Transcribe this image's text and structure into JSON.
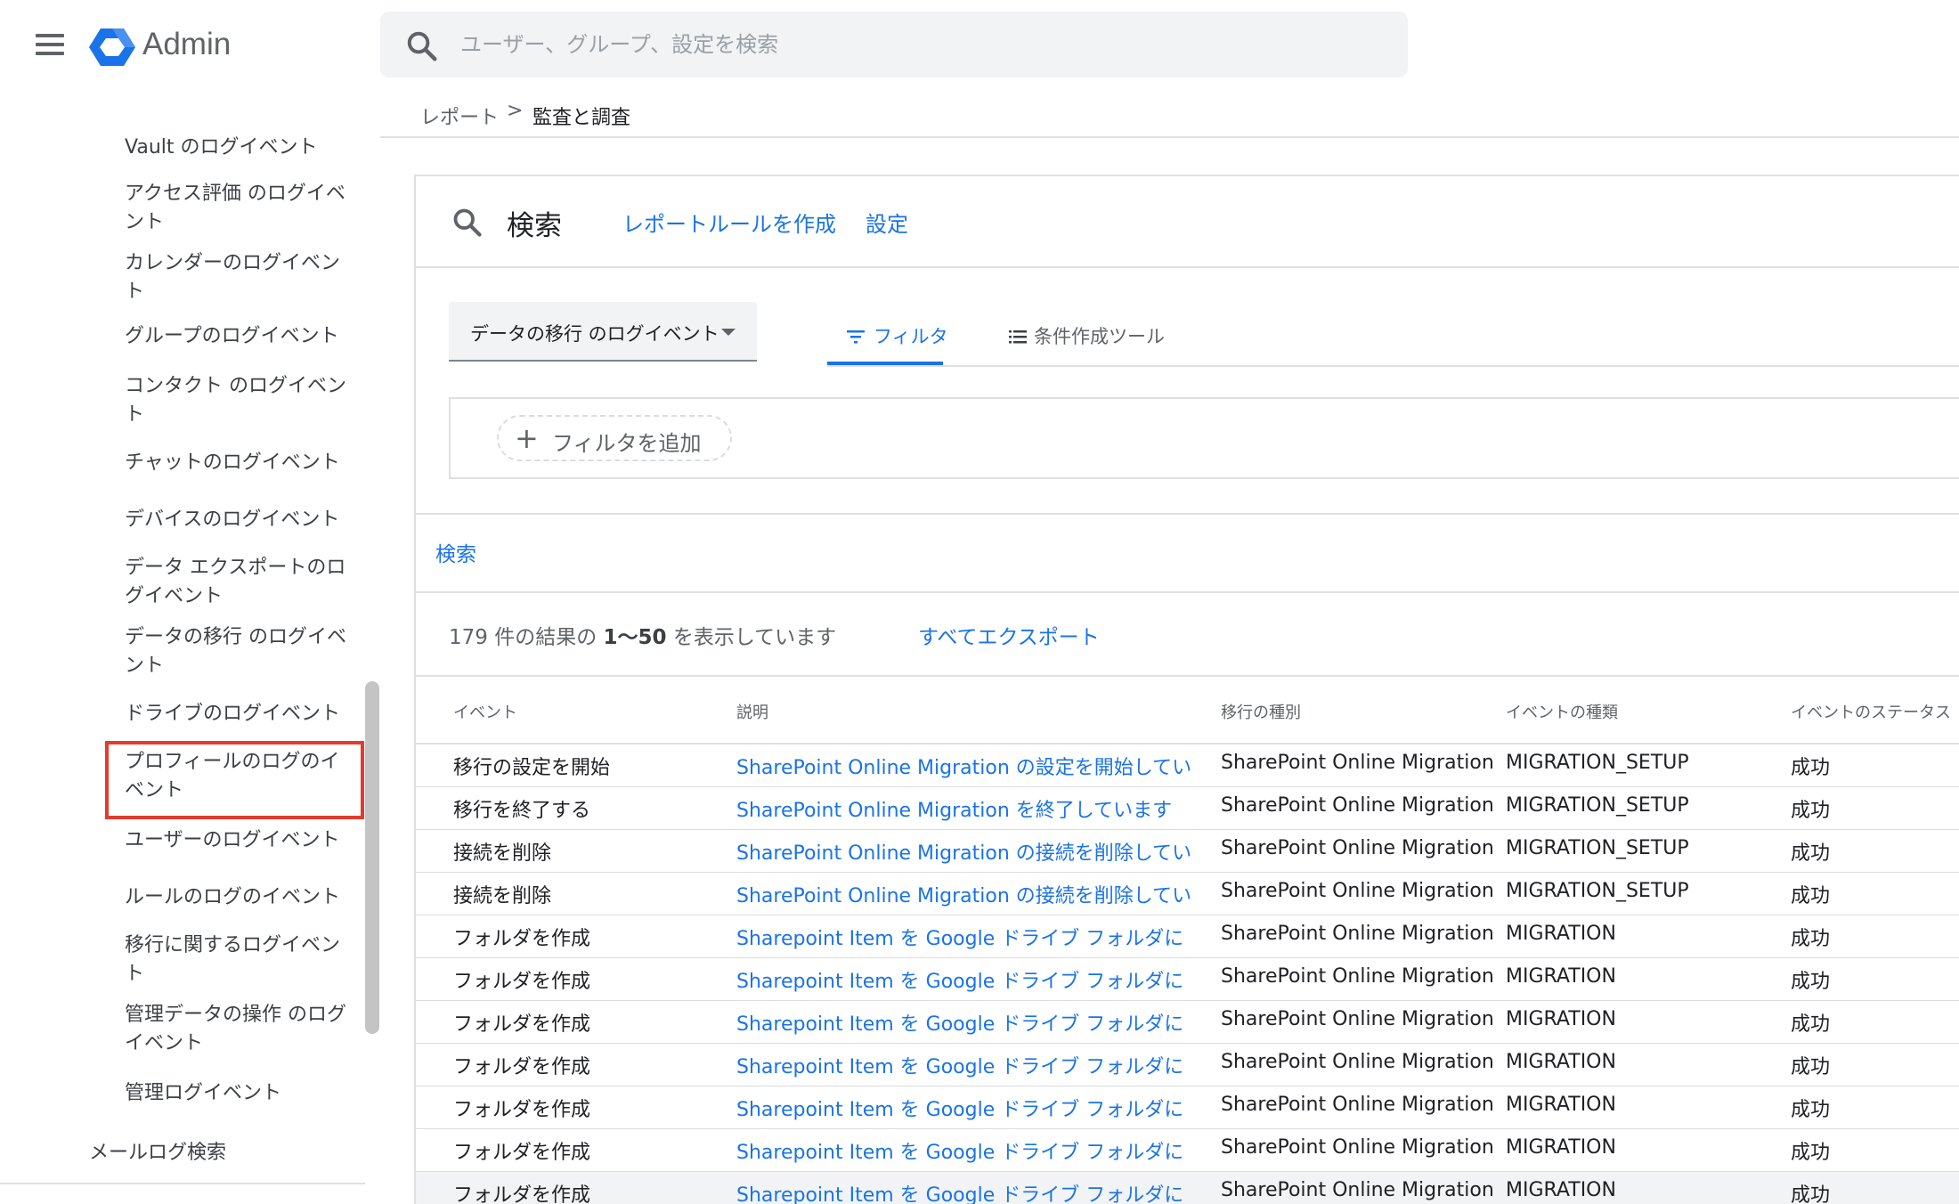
{
  "app": {
    "title": "Admin",
    "search_placeholder": "ユーザー、グループ、設定を検索"
  },
  "breadcrumb": {
    "parent": "レポート",
    "separator": ">",
    "current": "監査と調査"
  },
  "sidebar": {
    "items": [
      {
        "label": "Vault のログイベント"
      },
      {
        "label": "アクセス評価 のログイベント"
      },
      {
        "label": "カレンダーのログイベント"
      },
      {
        "label": "グループのログイベント"
      },
      {
        "label": "コンタクト のログイベント"
      },
      {
        "label": "チャットのログイベント"
      },
      {
        "label": "デバイスのログイベント"
      },
      {
        "label": "データ エクスポートのログイベント"
      },
      {
        "label": "データの移行 のログイベント",
        "selected": true
      },
      {
        "label": "ドライブのログイベント"
      },
      {
        "label": "プロフィールのログのイベント"
      },
      {
        "label": "ユーザーのログイベント"
      },
      {
        "label": "ルールのログのイベント"
      },
      {
        "label": "移行に関するログイベント"
      },
      {
        "label": "管理データの操作 のログイベント"
      },
      {
        "label": "管理ログイベント"
      }
    ],
    "mail_search": "メールログ検索",
    "highlight_color": "#e53b2c"
  },
  "card": {
    "title": "検索",
    "create_rule_link": "レポートルールを作成",
    "settings_link": "設定",
    "data_source": "データの移行 のログイベント",
    "tabs": {
      "filter": "フィルタ",
      "builder": "条件作成ツール"
    },
    "add_filter": "フィルタを追加",
    "search_button": "検索",
    "results_prefix": "179 件の結果の",
    "results_range": "1〜50",
    "results_suffix": "を表示しています",
    "export_all": "すべてエクスポート"
  },
  "table": {
    "headers": [
      "イベント",
      "説明",
      "移行の種別",
      "イベントの種類",
      "イベントのステータス"
    ],
    "rows": [
      [
        "移行の設定を開始",
        "SharePoint Online Migration の設定を開始してい",
        "SharePoint Online Migration",
        "MIGRATION_SETUP",
        "成功"
      ],
      [
        "移行を終了する",
        "SharePoint Online Migration を終了しています",
        "SharePoint Online Migration",
        "MIGRATION_SETUP",
        "成功"
      ],
      [
        "接続を削除",
        "SharePoint Online Migration の接続を削除してい",
        "SharePoint Online Migration",
        "MIGRATION_SETUP",
        "成功"
      ],
      [
        "接続を削除",
        "SharePoint Online Migration の接続を削除してい",
        "SharePoint Online Migration",
        "MIGRATION_SETUP",
        "成功"
      ],
      [
        "フォルダを作成",
        "Sharepoint Item を Google ドライブ フォルダに",
        "SharePoint Online Migration",
        "MIGRATION",
        "成功"
      ],
      [
        "フォルダを作成",
        "Sharepoint Item を Google ドライブ フォルダに",
        "SharePoint Online Migration",
        "MIGRATION",
        "成功"
      ],
      [
        "フォルダを作成",
        "Sharepoint Item を Google ドライブ フォルダに",
        "SharePoint Online Migration",
        "MIGRATION",
        "成功"
      ],
      [
        "フォルダを作成",
        "Sharepoint Item を Google ドライブ フォルダに",
        "SharePoint Online Migration",
        "MIGRATION",
        "成功"
      ],
      [
        "フォルダを作成",
        "Sharepoint Item を Google ドライブ フォルダに",
        "SharePoint Online Migration",
        "MIGRATION",
        "成功"
      ],
      [
        "フォルダを作成",
        "Sharepoint Item を Google ドライブ フォルダに",
        "SharePoint Online Migration",
        "MIGRATION",
        "成功"
      ],
      [
        "フォルダを作成",
        "Sharepoint Item を Google ドライブ フォルダに",
        "SharePoint Online Migration",
        "MIGRATION",
        "成功"
      ]
    ]
  },
  "colors": {
    "link": "#1a73e8",
    "logo_blue": "#1a73e8"
  }
}
